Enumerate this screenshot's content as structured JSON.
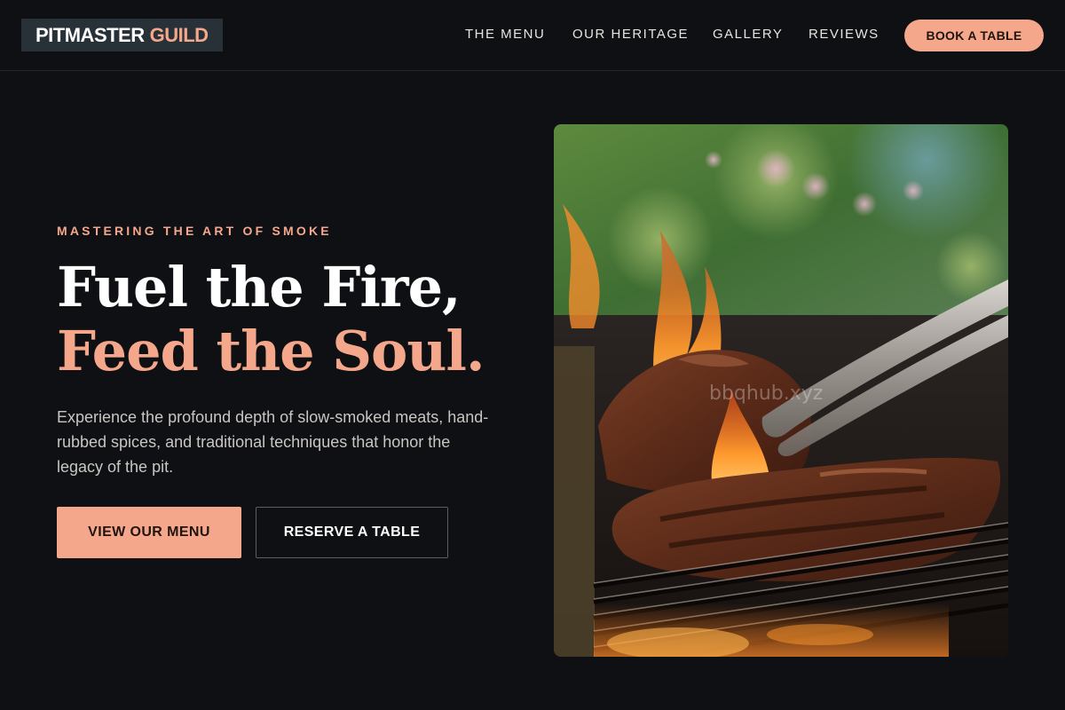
{
  "brand": {
    "name_part1": "PITMASTER",
    "name_part2": "GUILD"
  },
  "nav": {
    "links": [
      "THE MENU",
      "OUR HERITAGE",
      "GALLERY",
      "REVIEWS"
    ],
    "cta_label": "BOOK A TABLE"
  },
  "hero": {
    "eyebrow": "MASTERING THE ART OF SMOKE",
    "headline_line1": "Fuel the Fire,",
    "headline_line2": "Feed the Soul.",
    "description": "Experience the profound depth of slow-smoked meats, hand-rubbed spices, and traditional techniques that honor the legacy of the pit.",
    "primary_button": "VIEW OUR MENU",
    "secondary_button": "RESERVE A TABLE",
    "image_watermark": "bbqhub.xyz"
  },
  "colors": {
    "accent": "#f4a78a",
    "background": "#0e1014",
    "logo_bg": "#283038"
  },
  "icons": {
    "hero_image": "grilled-steak-photo"
  }
}
